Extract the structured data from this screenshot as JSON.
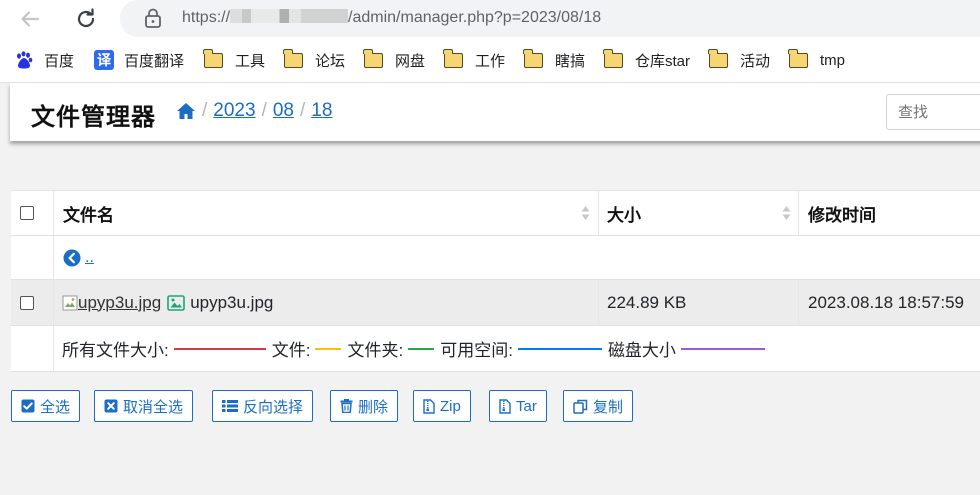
{
  "browser": {
    "url_prefix": "https://",
    "url_suffix": "/admin/manager.php?p=2023/08/18"
  },
  "bookmarks": [
    {
      "label": "百度",
      "icon": "baidu-paw-icon"
    },
    {
      "label": "百度翻译",
      "icon": "translate-icon"
    },
    {
      "label": "工具",
      "icon": "folder-icon"
    },
    {
      "label": "论坛",
      "icon": "folder-icon"
    },
    {
      "label": "网盘",
      "icon": "folder-icon"
    },
    {
      "label": "工作",
      "icon": "folder-icon"
    },
    {
      "label": "瞎搞",
      "icon": "folder-icon"
    },
    {
      "label": "仓库star",
      "icon": "folder-icon"
    },
    {
      "label": "活动",
      "icon": "folder-icon"
    },
    {
      "label": "tmp",
      "icon": "folder-icon"
    }
  ],
  "translate_glyph": "译",
  "header": {
    "title": "文件管理器",
    "breadcrumb": [
      "2023",
      "08",
      "18"
    ],
    "breadcrumb_sep": "/",
    "search_placeholder": "查找"
  },
  "table": {
    "columns": {
      "name": "文件名",
      "size": "大小",
      "modified": "修改时间"
    },
    "parent_link": "..",
    "files": [
      {
        "thumb_alt": "upyp3u.jpg",
        "name": "upyp3u.jpg",
        "size": "224.89 KB",
        "modified": "2023.08.18 18:57:59"
      }
    ],
    "totals": {
      "all_size": "所有文件大小:",
      "files": "文件:",
      "folders": "文件夹:",
      "free": "可用空间:",
      "disk": "磁盘大小"
    }
  },
  "colors": {
    "accent": "#1b6ec2",
    "line_all_size": "#dc3545",
    "line_files": "#ffc107",
    "line_folders": "#28a745",
    "line_free": "#007bff",
    "line_disk": "#9b59e0"
  },
  "actions": {
    "select_all": "全选",
    "unselect_all": "取消全选",
    "invert": "反向选择",
    "delete": "删除",
    "zip": "Zip",
    "tar": "Tar",
    "copy": "复制"
  }
}
